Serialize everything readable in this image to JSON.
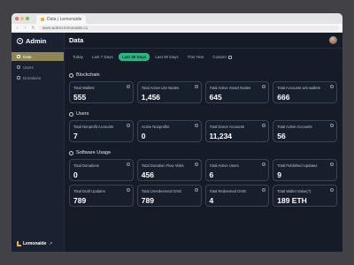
{
  "browser": {
    "tab_title": "Data | Lemonaide",
    "url": "www.admin.lemonaide.co"
  },
  "sidebar": {
    "brand": "Admin",
    "items": [
      {
        "label": "Data",
        "icon": "grid-icon",
        "active": true
      },
      {
        "label": "Users",
        "icon": "user-icon",
        "active": false
      },
      {
        "label": "Donations",
        "icon": "gift-icon",
        "active": false
      }
    ],
    "footer": "Lemonaide"
  },
  "header": {
    "title": "Data"
  },
  "filters": [
    "Today",
    "Last 7 Days",
    "Last 30 Days",
    "Last 90 Days",
    "This Year",
    "Custom"
  ],
  "active_filter": "Last 30 Days",
  "sections": [
    {
      "title": "Blockchain",
      "cards": [
        {
          "label": "Total Wallets",
          "value": "555"
        },
        {
          "label": "Total Active Lite Nodes",
          "value": "1,456"
        },
        {
          "label": "Total Active Smart Nodes",
          "value": "645"
        },
        {
          "label": "Total Accounts w/o wallets",
          "value": "666"
        }
      ]
    },
    {
      "title": "Users",
      "cards": [
        {
          "label": "Total Nonprofit Accounts",
          "value": "7"
        },
        {
          "label": "Active Nonprofits",
          "value": "0"
        },
        {
          "label": "Total Donor Accounts",
          "value": "11,234"
        },
        {
          "label": "Total Active Accounts",
          "value": "56"
        }
      ]
    },
    {
      "title": "Software Usage",
      "cards": [
        {
          "label": "Total Donations",
          "value": "0"
        },
        {
          "label": "Total Donation Flow Visits",
          "value": "456"
        },
        {
          "label": "Total Active Users",
          "value": "6"
        },
        {
          "label": "Total Published Updates",
          "value": "9"
        },
        {
          "label": "Total Draft Updates",
          "value": "789"
        },
        {
          "label": "Total Unredeemed GIVE",
          "value": "789"
        },
        {
          "label": "Total Redeemed GIVE",
          "value": "4"
        },
        {
          "label": "Total Wallet Value(?)",
          "value": "189 ETH"
        }
      ]
    }
  ],
  "colors": {
    "accent": "#2fb584",
    "sidebar_active": "#8f8453",
    "background": "#151b27",
    "card_border": "#3a4353"
  }
}
